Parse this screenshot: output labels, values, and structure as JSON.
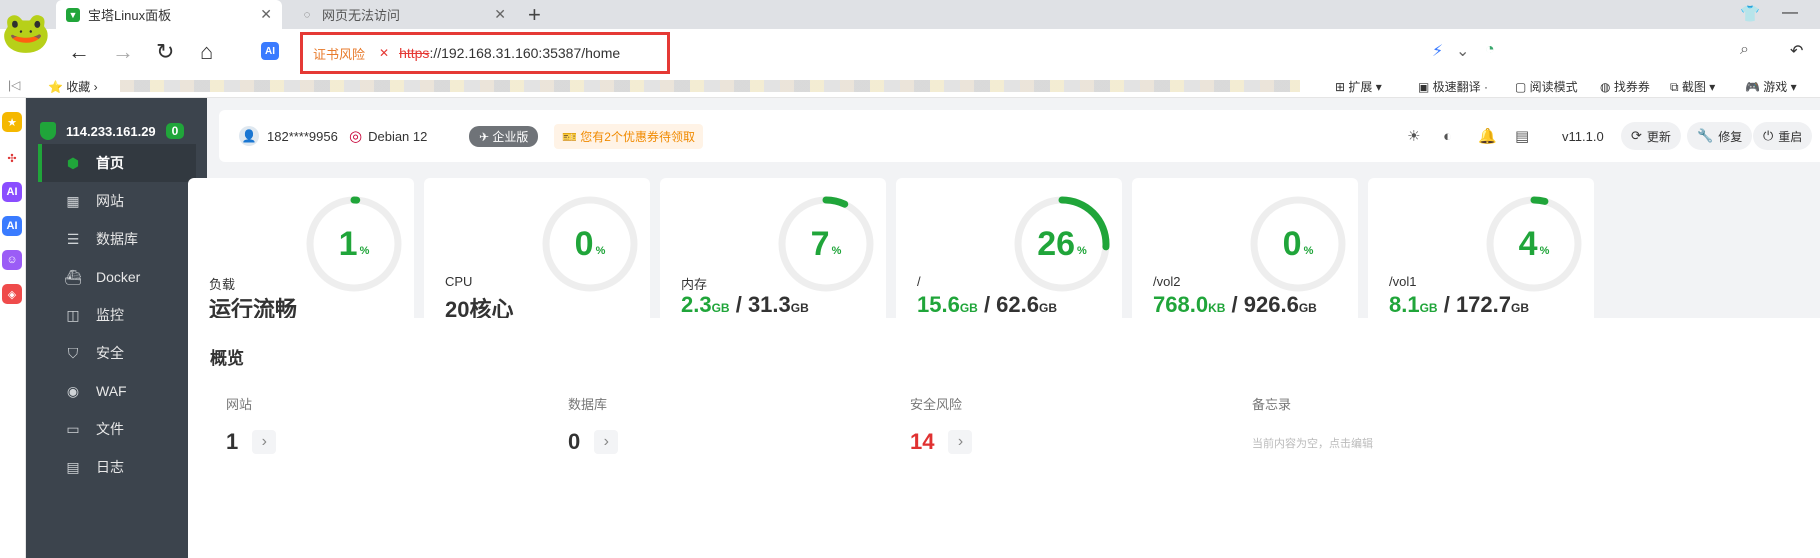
{
  "browser": {
    "tabs": [
      {
        "title": "宝塔Linux面板",
        "active": true
      },
      {
        "title": "网页无法访问",
        "active": false
      }
    ],
    "address": {
      "cert_warning": "证书风险",
      "https": "https",
      "rest": "://192.168.31.160:35387/home"
    },
    "bookmarks": {
      "favorites": "收藏",
      "extensions": "扩展",
      "translate": "极速翻译",
      "reader": "阅读模式",
      "coupons": "找券券",
      "screenshot": "截图",
      "games": "游戏"
    }
  },
  "sidebar": {
    "ip": "114.233.161.29",
    "badge": "0",
    "items": [
      {
        "label": "首页",
        "icon": "home-icon",
        "active": true
      },
      {
        "label": "网站",
        "icon": "website-icon"
      },
      {
        "label": "数据库",
        "icon": "database-icon"
      },
      {
        "label": "Docker",
        "icon": "docker-icon"
      },
      {
        "label": "监控",
        "icon": "monitor-icon"
      },
      {
        "label": "安全",
        "icon": "shield-icon"
      },
      {
        "label": "WAF",
        "icon": "waf-icon"
      },
      {
        "label": "文件",
        "icon": "folder-icon"
      },
      {
        "label": "日志",
        "icon": "log-icon"
      }
    ]
  },
  "topbar": {
    "user": "182****9956",
    "os": "Debian 12",
    "edition": "企业版",
    "coupon": "您有2个优惠券待领取",
    "version": "v11.1.0",
    "buttons": {
      "update": "更新",
      "repair": "修复",
      "restart": "重启"
    }
  },
  "cards": [
    {
      "value": "1",
      "pct": 1,
      "label": "负载",
      "main": "运行流畅"
    },
    {
      "value": "0",
      "pct": 0,
      "label": "CPU",
      "main": "20核心"
    },
    {
      "value": "7",
      "pct": 7,
      "label": "内存",
      "used": "2.3",
      "used_unit": "GB",
      "total": "31.3",
      "total_unit": "GB"
    },
    {
      "value": "26",
      "pct": 26,
      "label": "/",
      "used": "15.6",
      "used_unit": "GB",
      "total": "62.6",
      "total_unit": "GB"
    },
    {
      "value": "0",
      "pct": 0,
      "label": "/vol2",
      "used": "768.0",
      "used_unit": "KB",
      "total": "926.6",
      "total_unit": "GB"
    },
    {
      "value": "4",
      "pct": 4,
      "label": "/vol1",
      "used": "8.1",
      "used_unit": "GB",
      "total": "172.7",
      "total_unit": "GB"
    }
  ],
  "pct_sign": "%",
  "overview": {
    "title": "概览",
    "websites": {
      "label": "网站",
      "value": "1"
    },
    "databases": {
      "label": "数据库",
      "value": "0"
    },
    "security": {
      "label": "安全风险",
      "value": "14"
    },
    "memo": {
      "label": "备忘录",
      "text": "当前内容为空，点击编辑"
    }
  },
  "colors": {
    "accent": "#20a53a",
    "danger": "#e03131",
    "sidebar": "#3c444d"
  }
}
